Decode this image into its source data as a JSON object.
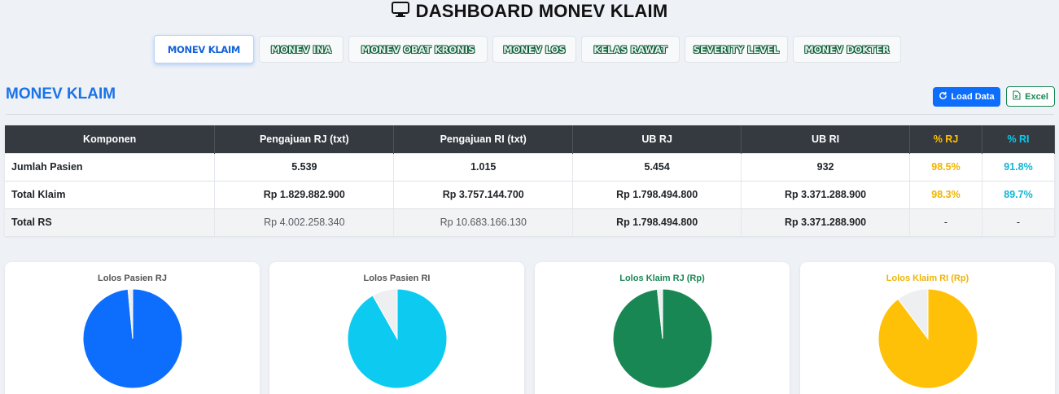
{
  "header": {
    "title": "DASHBOARD MONEV KLAIM",
    "icon": "monitor-icon"
  },
  "tabs": [
    {
      "label": "MONEV KLAIM",
      "active": true
    },
    {
      "label": "MONEV INA",
      "active": false
    },
    {
      "label": "MONEV OBAT KRONIS",
      "active": false
    },
    {
      "label": "MONEV LOS",
      "active": false
    },
    {
      "label": "KELAS RAWAT",
      "active": false
    },
    {
      "label": "SEVERITY LEVEL",
      "active": false
    },
    {
      "label": "MONEV DOKTER",
      "active": false
    }
  ],
  "section": {
    "title": "MONEV KLAIM"
  },
  "buttons": {
    "load": "Load Data",
    "excel": "Excel"
  },
  "table": {
    "headers": [
      "Komponen",
      "Pengajuan RJ (txt)",
      "Pengajuan RI (txt)",
      "UB RJ",
      "UB RI",
      "% RJ",
      "% RI"
    ],
    "rows": [
      [
        "Jumlah Pasien",
        "5.539",
        "1.015",
        "5.454",
        "932",
        "98.5%",
        "91.8%"
      ],
      [
        "Total Klaim",
        "Rp 1.829.882.900",
        "Rp 3.757.144.700",
        "Rp 1.798.494.800",
        "Rp 3.371.288.900",
        "98.3%",
        "89.7%"
      ],
      [
        "Total RS",
        "Rp 4.002.258.340",
        "Rp 10.683.166.130",
        "Rp 1.798.494.800",
        "Rp 3.371.288.900",
        "-",
        "-"
      ]
    ]
  },
  "charts": [
    {
      "title": "Lolos Pasien RJ",
      "lolos_pct": 98.5,
      "color": "#0d6efd",
      "title_color": "#555555"
    },
    {
      "title": "Lolos Pasien RI",
      "lolos_pct": 91.8,
      "color": "#0dcaf0",
      "title_color": "#555555"
    },
    {
      "title": "Lolos Klaim RJ (Rp)",
      "lolos_pct": 98.3,
      "color": "#198754",
      "title_color": "#198754"
    },
    {
      "title": "Lolos Klaim RI (Rp)",
      "lolos_pct": 89.7,
      "color": "#ffc107",
      "title_color": "#f0b400"
    }
  ],
  "colors": {
    "primary": "#0d6efd",
    "success": "#198754",
    "warning": "#ffc107",
    "info": "#0dcaf0",
    "remainder": "#eeeff1"
  }
}
